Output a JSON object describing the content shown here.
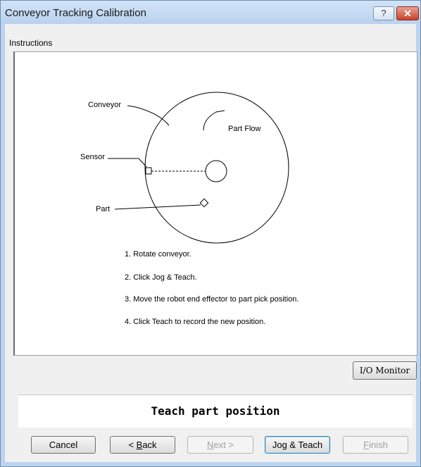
{
  "window": {
    "title": "Conveyor Tracking Calibration",
    "help_glyph": "?",
    "close_glyph": "✕"
  },
  "instructions": {
    "label": "Instructions",
    "diagram_labels": {
      "conveyor": "Conveyor",
      "part_flow": "Part Flow",
      "sensor": "Sensor",
      "part": "Part"
    },
    "steps": [
      "1. Rotate conveyor.",
      "2. Click Jog & Teach.",
      "3. Move the robot end effector to part pick position.",
      "4. Click Teach to record the new position."
    ]
  },
  "io_monitor_label": "I/O Monitor",
  "status_text": "Teach part position",
  "buttons": {
    "cancel": "Cancel",
    "back_prefix": "< ",
    "back_mnemonic": "B",
    "back_rest": "ack",
    "next_mnemonic": "N",
    "next_rest": "ext >",
    "jog_teach": "Jog & Teach",
    "finish_mnemonic": "F",
    "finish_rest": "inish"
  }
}
